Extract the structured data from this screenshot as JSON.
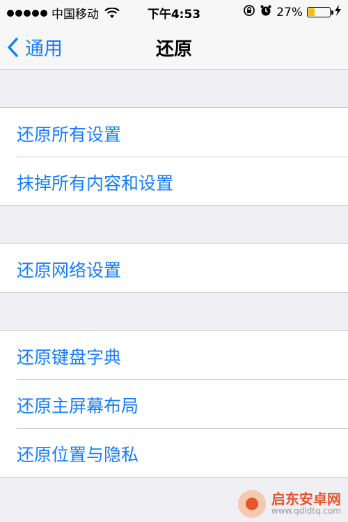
{
  "status_bar": {
    "carrier": "中国移动",
    "time": "下午4:53",
    "battery_percent": "27%",
    "battery_level": 0.27
  },
  "nav": {
    "back_label": "通用",
    "title": "还原"
  },
  "groups": [
    {
      "items": [
        {
          "label": "还原所有设置"
        },
        {
          "label": "抹掉所有内容和设置"
        }
      ]
    },
    {
      "items": [
        {
          "label": "还原网络设置"
        }
      ]
    },
    {
      "items": [
        {
          "label": "还原键盘字典"
        },
        {
          "label": "还原主屏幕布局"
        },
        {
          "label": "还原位置与隐私"
        }
      ]
    }
  ],
  "watermark": {
    "name": "启东安卓网",
    "url": "www.qdldtq.com"
  },
  "colors": {
    "accent": "#157efb",
    "background": "#efeff4",
    "battery": "#f3c000"
  }
}
